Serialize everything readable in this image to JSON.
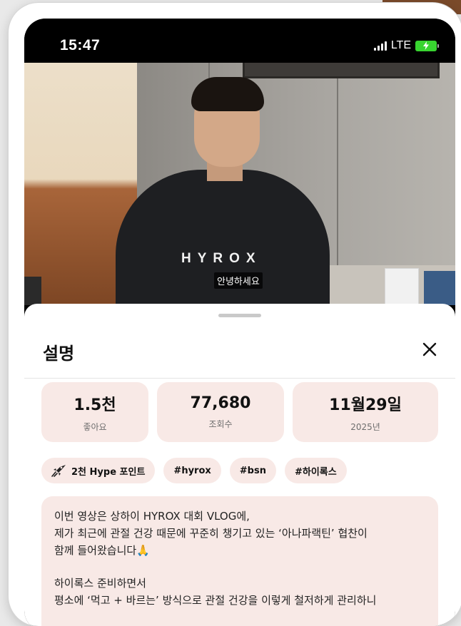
{
  "status_bar": {
    "time": "15:47",
    "network": "LTE",
    "battery_color": "#38d430"
  },
  "video": {
    "hoodie_text": "HYROX",
    "caption": "안녕하세요"
  },
  "sheet": {
    "title": "설명",
    "close_icon": "close-icon",
    "stats": [
      {
        "value": "1.5천",
        "label": "좋아요"
      },
      {
        "value": "77,680",
        "label": "조회수"
      },
      {
        "value": "11월29일",
        "label": "2025년"
      }
    ],
    "chips": [
      {
        "label": "2천 Hype 포인트",
        "icon": "rocket-icon"
      },
      {
        "label": "#hyrox"
      },
      {
        "label": "#bsn"
      },
      {
        "label": "#하이록스"
      }
    ],
    "description": {
      "line1": "이번 영상은 상하이 HYROX 대회 VLOG에,",
      "line2": "제가 최근에 관절 건강 때문에 꾸준히 챙기고 있는 ‘아나파랙틴’ 협찬이",
      "line3": "함께 들어왔습니다🙏",
      "line4": "하이록스 준비하면서",
      "line5": "평소에 ‘먹고 + 바르는’ 방식으로 관절 건강을 이렇게 철저하게 관리하니"
    }
  },
  "colors": {
    "card_bg": "#f8e9e6",
    "sheet_bg": "#ffffff"
  }
}
